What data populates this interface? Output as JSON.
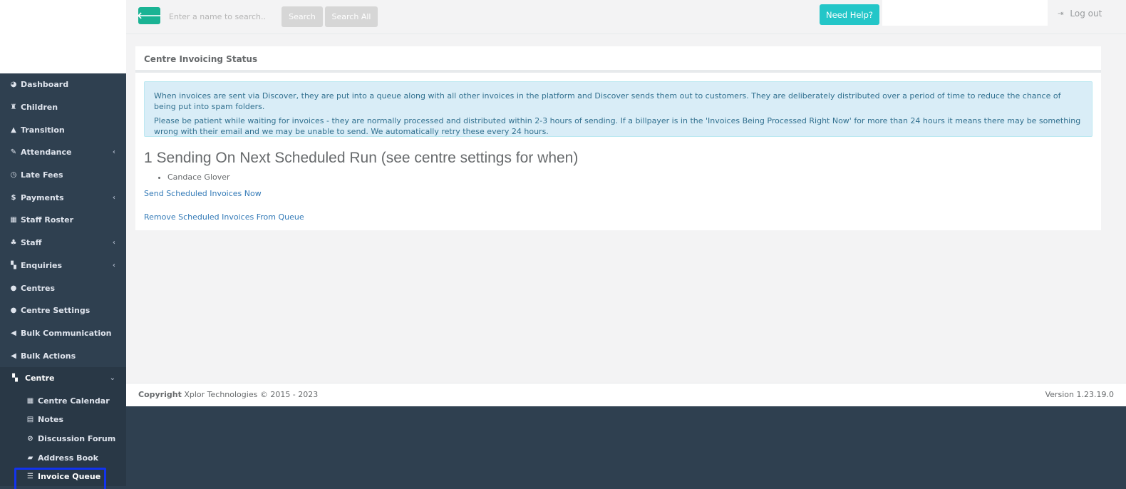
{
  "topbar": {
    "back_icon": "arrow-left-icon",
    "search_placeholder": "Enter a name to search..",
    "search_label": "Search",
    "search_all_label": "Search All",
    "help_label": "Need Help?",
    "logout_label": "Log out"
  },
  "sidebar": {
    "items": [
      {
        "label": "Dashboard",
        "icon": "pie-chart-icon"
      },
      {
        "label": "Children",
        "icon": "child-icon"
      },
      {
        "label": "Transition",
        "icon": "graduation-cap-icon"
      },
      {
        "label": "Attendance",
        "icon": "edit-icon",
        "has_children": true
      },
      {
        "label": "Late Fees",
        "icon": "clock-icon"
      },
      {
        "label": "Payments",
        "icon": "dollar-icon",
        "has_children": true
      },
      {
        "label": "Staff Roster",
        "icon": "calendar-icon"
      },
      {
        "label": "Staff",
        "icon": "sitemap-icon",
        "has_children": true
      },
      {
        "label": "Enquiries",
        "icon": "grid-icon",
        "has_children": true
      },
      {
        "label": "Centres",
        "icon": "circle-icon"
      },
      {
        "label": "Centre Settings",
        "icon": "circle-icon"
      },
      {
        "label": "Bulk Communication",
        "icon": "bullhorn-icon"
      },
      {
        "label": "Bulk Actions",
        "icon": "bullhorn-icon"
      }
    ],
    "open_section": {
      "label": "Centre",
      "icon": "grid-icon",
      "children": [
        {
          "label": "Centre Calendar",
          "icon": "calendar-icon"
        },
        {
          "label": "Notes",
          "icon": "file-icon"
        },
        {
          "label": "Discussion Forum",
          "icon": "comments-icon"
        },
        {
          "label": "Address Book",
          "icon": "book-icon"
        },
        {
          "label": "Invoice Queue",
          "icon": "list-icon",
          "active": true
        }
      ]
    }
  },
  "main": {
    "title": "Centre Invoicing Status",
    "alert_line1": "When invoices are sent via Discover, they are put into a queue along with all other invoices in the platform and Discover sends them out to customers. They are deliberately distributed over a period of time to reduce the chance of being put into spam folders.",
    "alert_line2": "Please be patient while waiting for invoices - they are normally processed and distributed within 2-3 hours of sending. If a billpayer is in the 'Invoices Being Processed Right Now' for more than 24 hours it means there may be something wrong with their email and we may be unable to send. We automatically retry these every 24 hours.",
    "heading": "1 Sending On Next Scheduled Run (see centre settings for when)",
    "recipients": [
      "Candace Glover"
    ],
    "send_link": "Send Scheduled Invoices Now",
    "remove_link": "Remove Scheduled Invoices From Queue"
  },
  "footer": {
    "copyright_label": "Copyright",
    "copyright_text": " Xplor Technologies © 2015 - 2023",
    "version": "Version 1.23.19.0"
  }
}
